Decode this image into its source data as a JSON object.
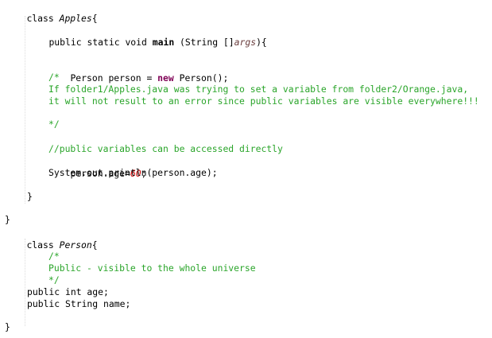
{
  "code": {
    "l1": {
      "kw": "class",
      "name": "Apples",
      "brace": "{"
    },
    "l2": {
      "mods": "public static void ",
      "method": "main",
      "sig_a": " (String []",
      "param": "args",
      "sig_b": "){"
    },
    "l3": {
      "a": "Person person = ",
      "kw": "new",
      "b": " Person();"
    },
    "l4": "/*",
    "l5": "If folder1/Apples.java was trying to set a variable from folder2/Orange.java,",
    "l6": "it will not result to an error since public variables are visible everywhere!!!",
    "l7": "*/",
    "l8": "//public variables can be accessed directly",
    "l9": {
      "a": "person.age=",
      "num": "60",
      "b": ";"
    },
    "l10": "System.out.println(person.age);",
    "l11": "}",
    "l12": "}",
    "l13": {
      "kw": "class",
      "name": "Person",
      "brace": "{"
    },
    "l14": "/*",
    "l15": "Public - visible to the whole universe",
    "l16": "*/",
    "l17": "public int age;",
    "l18": "public String name;",
    "l19": "}"
  }
}
